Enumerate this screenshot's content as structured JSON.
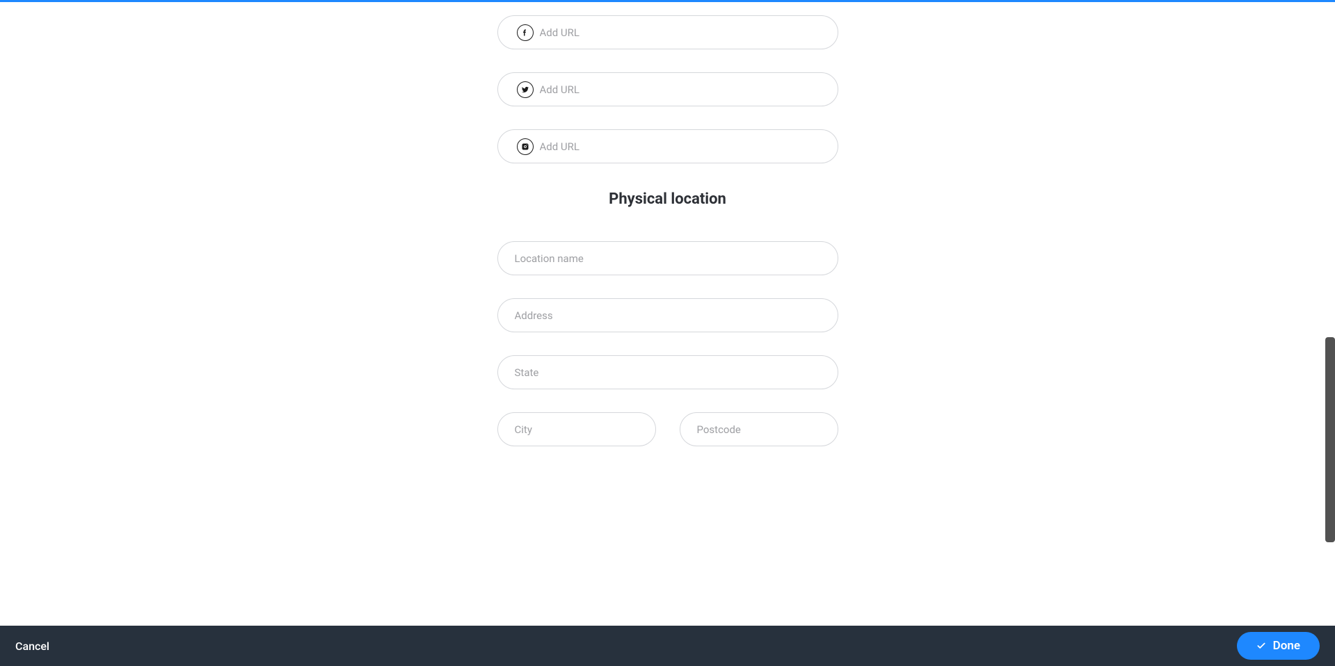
{
  "social": {
    "facebook": {
      "placeholder": "Add URL",
      "value": ""
    },
    "twitter": {
      "placeholder": "Add URL",
      "value": ""
    },
    "instagram": {
      "placeholder": "Add URL",
      "value": ""
    }
  },
  "location": {
    "title": "Physical location",
    "name": {
      "placeholder": "Location name",
      "value": ""
    },
    "address": {
      "placeholder": "Address",
      "value": ""
    },
    "state": {
      "placeholder": "State",
      "value": ""
    },
    "city": {
      "placeholder": "City",
      "value": ""
    },
    "postcode": {
      "placeholder": "Postcode",
      "value": ""
    }
  },
  "footer": {
    "cancel_label": "Cancel",
    "done_label": "Done"
  }
}
